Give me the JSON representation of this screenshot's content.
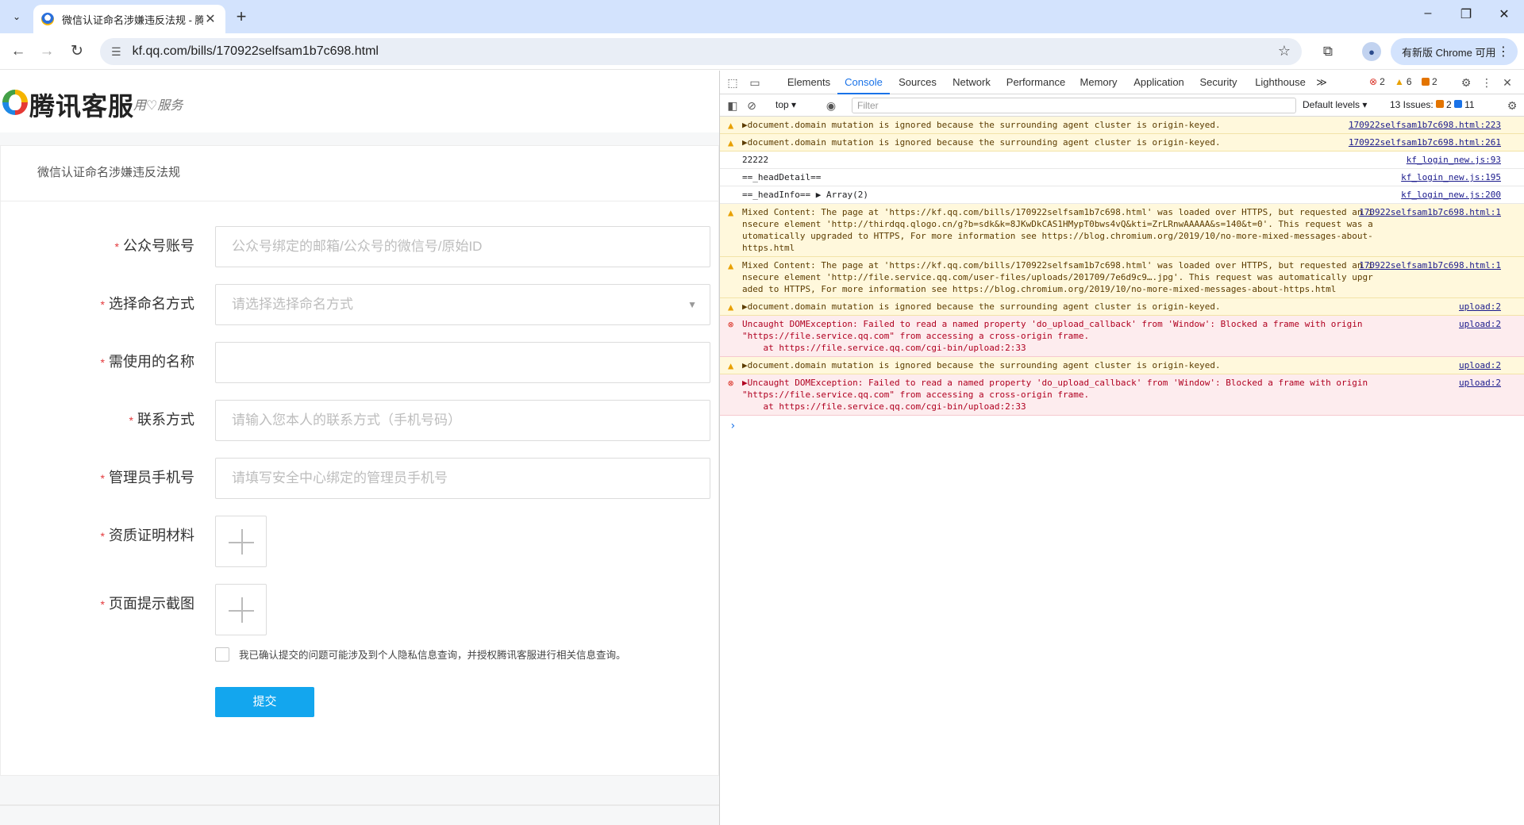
{
  "browser": {
    "tab_title": "微信认证命名涉嫌违反法规 - 腾",
    "new_tab": "+",
    "url": "kf.qq.com/bills/170922selfsam1b7c698.html",
    "update_label": "有新版 Chrome 可用",
    "window_controls": [
      "–",
      "❐",
      "✕"
    ]
  },
  "page": {
    "logo_text": "腾讯客服",
    "logo_slogan": "用♡服务",
    "card_title": "微信认证命名涉嫌违反法规",
    "fields": [
      {
        "label": "公众号账号",
        "placeholder": "公众号绑定的邮箱/公众号的微信号/原始ID"
      },
      {
        "label": "选择命名方式",
        "placeholder": "请选择选择命名方式"
      },
      {
        "label": "需使用的名称",
        "placeholder": ""
      },
      {
        "label": "联系方式",
        "placeholder": "请输入您本人的联系方式（手机号码）"
      },
      {
        "label": "管理员手机号",
        "placeholder": "请填写安全中心绑定的管理员手机号"
      }
    ],
    "uploads": [
      {
        "label": "资质证明材料"
      },
      {
        "label": "页面提示截图"
      }
    ],
    "required_mark": "*",
    "agree_text": "我已确认提交的问题可能涉及到个人隐私信息查询，并授权腾讯客服进行相关信息查询。",
    "submit_label": "提交"
  },
  "devtools": {
    "tabs": [
      "Elements",
      "Console",
      "Sources",
      "Network",
      "Performance",
      "Memory",
      "Application",
      "Security",
      "Lighthouse"
    ],
    "more_tabs": "≫",
    "error_count": "2",
    "warning_count": "6",
    "issue_count": "2",
    "context": "top",
    "filter_placeholder": "Filter",
    "levels": "Default levels",
    "issues_label": "13 Issues:",
    "issues_a": "2",
    "issues_b": "11",
    "messages": [
      {
        "level": "warn",
        "text": "▶document.domain mutation is ignored because the surrounding agent cluster is origin-keyed.",
        "source": "170922selfsam1b7c698.html:223"
      },
      {
        "level": "warn",
        "text": "▶document.domain mutation is ignored because the surrounding agent cluster is origin-keyed.",
        "source": "170922selfsam1b7c698.html:261"
      },
      {
        "level": "log",
        "text": "22222",
        "source": "kf_login_new.js:93"
      },
      {
        "level": "log",
        "text": "==_headDetail==",
        "source": "kf_login_new.js:195"
      },
      {
        "level": "log",
        "text": "==_headInfo== ▶ Array(2)",
        "source": "kf_login_new.js:200"
      },
      {
        "level": "warn",
        "text": "Mixed Content: The page at 'https://kf.qq.com/bills/170922selfsam1b7c698.html' was loaded over HTTPS, but requested an insecure element 'http://thirdqq.qlogo.cn/g?b=sdk&k=8JKwDkCAS1HMypT0bws4vQ&kti=ZrLRnwAAAAA&s=140&t=0'. This request was automatically upgraded to HTTPS, For more information see https://blog.chromium.org/2019/10/no-more-mixed-messages-about-https.html",
        "source": "170922selfsam1b7c698.html:1"
      },
      {
        "level": "warn",
        "text": "Mixed Content: The page at 'https://kf.qq.com/bills/170922selfsam1b7c698.html' was loaded over HTTPS, but requested an insecure element 'http://file.service.qq.com/user-files/uploads/201709/7e6d9c9….jpg'. This request was automatically upgraded to HTTPS, For more information see https://blog.chromium.org/2019/10/no-more-mixed-messages-about-https.html",
        "source": "170922selfsam1b7c698.html:1"
      },
      {
        "level": "warn",
        "text": "▶document.domain mutation is ignored because the surrounding agent cluster is origin-keyed.",
        "source": "upload:2"
      },
      {
        "level": "err",
        "text": "Uncaught DOMException: Failed to read a named property 'do_upload_callback' from 'Window': Blocked a frame with origin \"https://file.service.qq.com\" from accessing a cross-origin frame.\n    at https://file.service.qq.com/cgi-bin/upload:2:33",
        "source": "upload:2"
      },
      {
        "level": "warn",
        "text": "▶document.domain mutation is ignored because the surrounding agent cluster is origin-keyed.",
        "source": "upload:2"
      },
      {
        "level": "err",
        "text": "▶Uncaught DOMException: Failed to read a named property 'do_upload_callback' from 'Window': Blocked a frame with origin \"https://file.service.qq.com\" from accessing a cross-origin frame.\n    at https://file.service.qq.com/cgi-bin/upload:2:33",
        "source": "upload:2"
      }
    ],
    "prompt": "›"
  }
}
